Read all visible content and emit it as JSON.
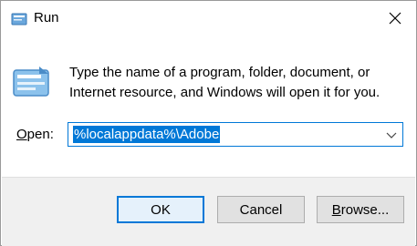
{
  "window": {
    "title": "Run",
    "close_icon": "close-icon"
  },
  "dialog": {
    "description_line1": "Type the name of a program, folder, document, or",
    "description_line2": "Internet resource, and Windows will open it for you.",
    "open_label_prefix": "",
    "open_label_hotkey": "O",
    "open_label_rest": "pen:",
    "open_value": "%localappdata%\\Adobe"
  },
  "buttons": {
    "ok_label": "OK",
    "cancel_label": "Cancel",
    "browse_label_hotkey": "B",
    "browse_label_rest": "rowse..."
  },
  "colors": {
    "accent": "#0078d7",
    "footer_bg": "#f0f0f0"
  }
}
